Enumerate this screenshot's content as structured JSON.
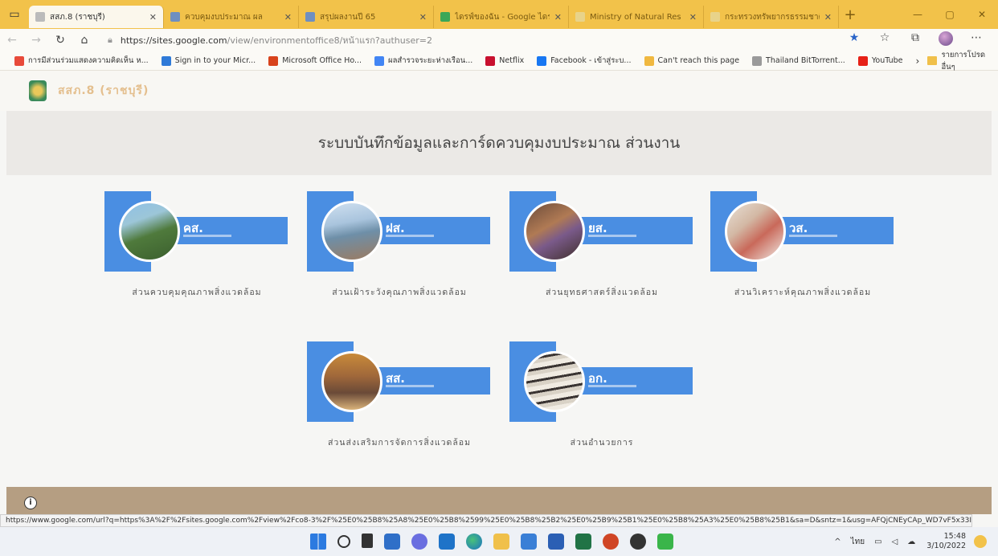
{
  "browser": {
    "tabs": [
      {
        "label": "สสภ.8 (ราชบุรี)",
        "active": true,
        "icon": "page-icon"
      },
      {
        "label": "ควบคุมงบประมาณ ผล",
        "active": false,
        "icon": "sheets-icon"
      },
      {
        "label": "สรุปผลงานปี 65",
        "active": false,
        "icon": "sheets-icon"
      },
      {
        "label": "ไดรฟ์ของฉัน - Google ไดรฟ์",
        "active": false,
        "icon": "drive-icon"
      },
      {
        "label": "Ministry of Natural Res",
        "active": false,
        "icon": "ministry-icon"
      },
      {
        "label": "กระทรวงทรัพยากรธรรมชาติ",
        "active": false,
        "icon": "ministry-icon"
      }
    ],
    "address": {
      "host": "https://sites.google.com",
      "path": "/view/environmentoffice8/หน้าแรก?authuser=2"
    },
    "bookmarks": [
      {
        "label": "การมีส่วนร่วมแสดงความคิดเห็น ห...",
        "icon": "windows-icon",
        "color": "#e84a3a"
      },
      {
        "label": "Sign in to your Micr...",
        "icon": "microsoft-icon",
        "color": "#2f7ad8"
      },
      {
        "label": "Microsoft Office Ho...",
        "icon": "office-icon",
        "color": "#d8431c"
      },
      {
        "label": "ผลสำรวจระยะห่างเรือน...",
        "icon": "google-icon",
        "color": "#4285f4"
      },
      {
        "label": "Netflix",
        "icon": "netflix-icon",
        "color": "#c8102e"
      },
      {
        "label": "Facebook - เข้าสู่ระบ...",
        "icon": "facebook-icon",
        "color": "#1877f2"
      },
      {
        "label": "Can't reach this page",
        "icon": "warning-icon",
        "color": "#f0b840"
      },
      {
        "label": "Thailand BitTorrent...",
        "icon": "torrent-icon",
        "color": "#9a9a9a"
      },
      {
        "label": "YouTube",
        "icon": "youtube-icon",
        "color": "#e62117"
      }
    ],
    "bookmarks_folder": "รายการโปรดอื่นๆ",
    "status_url": "https://www.google.com/url?q=https%3A%2F%2Fsites.google.com%2Fview%2Fco8-3%2F%25E0%25B8%25A8%25E0%25B8%2599%25E0%25B8%25B2%25E0%25B9%25B1%25E0%25B8%25A3%25E0%25B8%25B1&sa=D&sntz=1&usg=AFQjCNEyCAp_WD7vF5x33I4..."
  },
  "site": {
    "name": "สสภ.8 (ราชบุรี)",
    "banner_title": "ระบบบันทึกข้อมูลและการ์ดควบคุมงบประมาณ ส่วนงาน",
    "cards": [
      {
        "abbr": "คส.",
        "caption": "ส่วนควบคุมคุณภาพสิ่งแวดล้อม"
      },
      {
        "abbr": "ฝส.",
        "caption": "ส่วนเฝ้าระวังคุณภาพสิ่งแวดล้อม"
      },
      {
        "abbr": "ยส.",
        "caption": "ส่วนยุทธศาสตร์สิ่งแวดล้อม"
      },
      {
        "abbr": "วส.",
        "caption": "ส่วนวิเคราะห์คุณภาพสิ่งแวดล้อม"
      },
      {
        "abbr": "สส.",
        "caption": "ส่วนส่งเสริมการจัดการสิ่งแวดล้อม"
      },
      {
        "abbr": "อก.",
        "caption": "ส่วนอำนวยการ"
      }
    ],
    "accent_color": "#4a8ee2"
  },
  "taskbar": {
    "language": "ไทย",
    "time": "15:48",
    "date": "3/10/2022"
  }
}
